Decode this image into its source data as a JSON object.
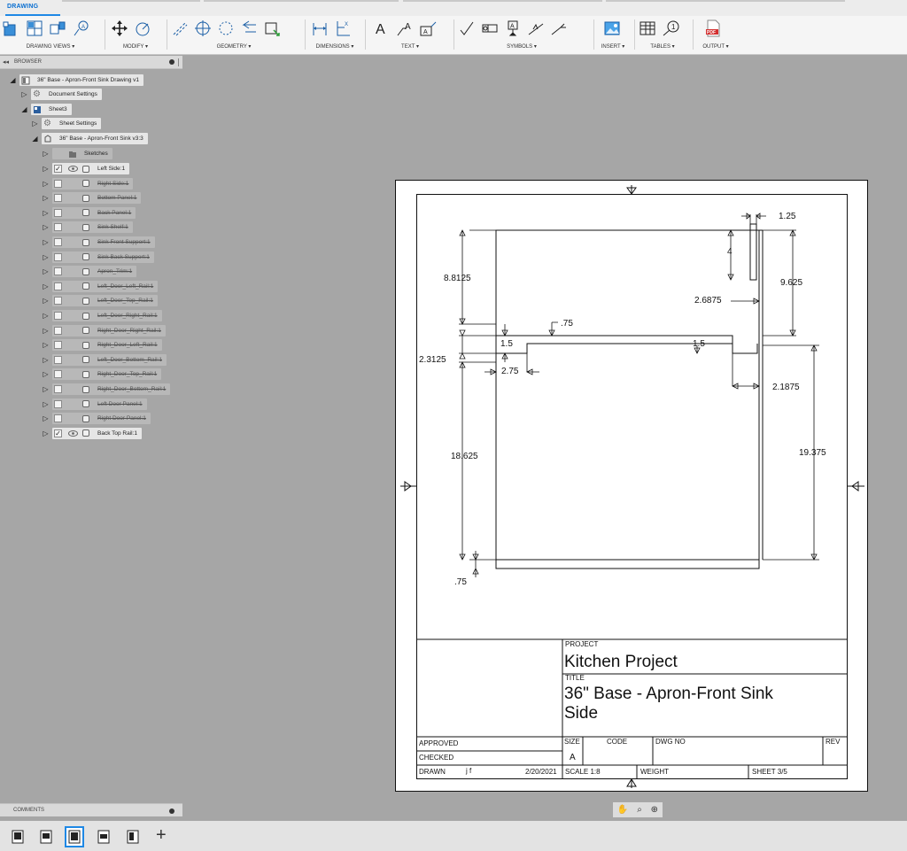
{
  "toolbar": {
    "active_tab": "DRAWING",
    "groups": {
      "drawing_views": "DRAWING VIEWS ▾",
      "modify": "MODIFY ▾",
      "geometry": "GEOMETRY ▾",
      "dimensions": "DIMENSIONS ▾",
      "text": "TEXT ▾",
      "symbols": "SYMBOLS ▾",
      "insert": "INSERT ▾",
      "tables": "TABLES ▾",
      "output": "OUTPUT ▾"
    }
  },
  "browser": {
    "title": "BROWSER",
    "root": "36\" Base - Apron-Front Sink Drawing v1",
    "document_settings": "Document Settings",
    "sheet": "Sheet3",
    "sheet_settings": "Sheet Settings",
    "component": "36\" Base - Apron-Front Sink v3:3",
    "sketches": "Sketches",
    "bodies": [
      {
        "label": "Left Side:1",
        "checked": true,
        "visible": true
      },
      {
        "label": "Right Side:1",
        "checked": false,
        "visible": false
      },
      {
        "label": "Bottom Panel:1",
        "checked": false,
        "visible": false
      },
      {
        "label": "Back Panel:1",
        "checked": false,
        "visible": false
      },
      {
        "label": "Sink Shelf:1",
        "checked": false,
        "visible": false
      },
      {
        "label": "Sink Front Support:1",
        "checked": false,
        "visible": false
      },
      {
        "label": "Sink Back Support:1",
        "checked": false,
        "visible": false
      },
      {
        "label": "Apron_Trim:1",
        "checked": false,
        "visible": false
      },
      {
        "label": "Left_Door_Left_Rail:1",
        "checked": false,
        "visible": false
      },
      {
        "label": "Left_Door_Top_Rail:1",
        "checked": false,
        "visible": false
      },
      {
        "label": "Left_Door_Right_Rail:1",
        "checked": false,
        "visible": false
      },
      {
        "label": "Right_Door_Right_Rail:1",
        "checked": false,
        "visible": false
      },
      {
        "label": "Right_Door_Left_Rail:1",
        "checked": false,
        "visible": false
      },
      {
        "label": "Left_Door_Bottom_Rail:1",
        "checked": false,
        "visible": false
      },
      {
        "label": "Right_Door_Top_Rail:1",
        "checked": false,
        "visible": false
      },
      {
        "label": "Right_Door_Bottom_Rail:1",
        "checked": false,
        "visible": false
      },
      {
        "label": "Left Door Panel:1",
        "checked": false,
        "visible": false
      },
      {
        "label": "Right Door Panel:1",
        "checked": false,
        "visible": false
      },
      {
        "label": "Back Top Rail:1",
        "checked": true,
        "visible": true
      }
    ]
  },
  "comments": {
    "title": "COMMENTS"
  },
  "drawing": {
    "dimensions": {
      "d1": "1.25",
      "d2": "4",
      "d3": "8.8125",
      "d4": "9.625",
      "d5": "2.6875",
      "d6": ".75",
      "d7": "1.5",
      "d8": "1.5",
      "d9": "2.3125",
      "d10": "2.75",
      "d11": "2.1875",
      "d12": "18.625",
      "d13": "19.375",
      "d14": ".75"
    },
    "title_block": {
      "project_label": "PROJECT",
      "project_value": "Kitchen Project",
      "title_label": "TITLE",
      "title_line1": "36\" Base - Apron-Front Sink",
      "title_line2": "Side",
      "approved": "APPROVED",
      "checked": "CHECKED",
      "drawn": "DRAWN",
      "drawn_by": "j f",
      "date": "2/20/2021",
      "size_label": "SIZE",
      "size_value": "A",
      "code_label": "CODE",
      "dwg_label": "DWG NO",
      "rev_label": "REV",
      "scale": "SCALE  1:8",
      "weight": "WEIGHT",
      "sheet": "SHEET  3/5"
    }
  },
  "colors": {
    "accent": "#1e88e5",
    "canvas": "#a6a6a6",
    "paper": "#ffffff"
  }
}
